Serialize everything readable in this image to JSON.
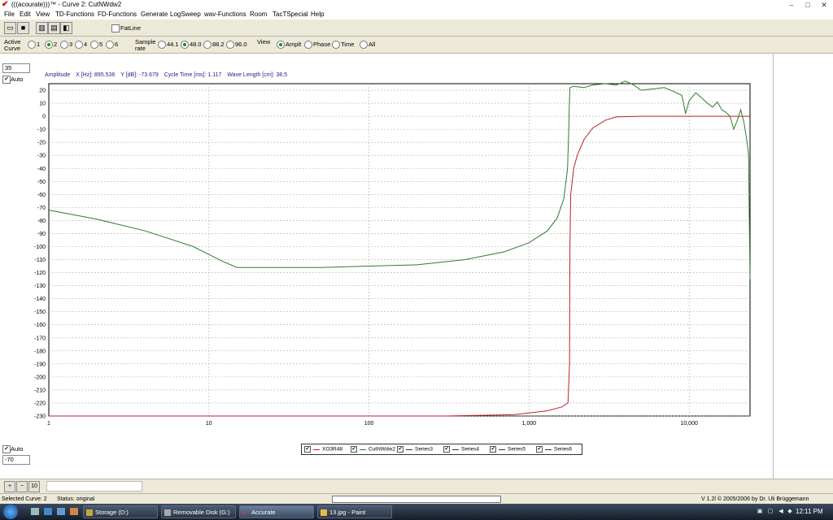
{
  "window": {
    "title": "(((acourate)))™ - Curve 2: CutNWdw2",
    "minimize": "–",
    "maximize": "□",
    "close": "✕"
  },
  "menu": [
    "File",
    "Edit",
    "View",
    "TD-Functions",
    "FD-Functions",
    "Generate",
    "LogSweep",
    "wav-Functions",
    "Room",
    "TacTSpecial",
    "Help"
  ],
  "toolbar": {
    "fatline_label": "FatLine",
    "fatline_checked": false,
    "icons": [
      "open-folder-icon",
      "save-disk-icon",
      "copy-icon",
      "paste-icon",
      "eraser-icon"
    ]
  },
  "options": {
    "active_curve_label": "Active Curve",
    "active_curve_label_line1": "Active",
    "active_curve_label_line2": "Curve",
    "curves": [
      "1",
      "2",
      "3",
      "4",
      "5",
      "6"
    ],
    "active_curve_selected": "2",
    "sample_rate_label_line1": "Sample",
    "sample_rate_label_line2": "rate",
    "sample_rates": [
      "44.1",
      "48.0",
      "88.2",
      "96.0"
    ],
    "sample_rate_selected": "48.0",
    "view_label": "View",
    "views": [
      "Amplt",
      "Phase",
      "Time",
      "All"
    ],
    "view_selected": "Amplt"
  },
  "plot": {
    "y_max_input": "35",
    "y_min_input": "-70",
    "auto_top_label": "Auto",
    "auto_bottom_label": "Auto",
    "auto_top_checked": true,
    "auto_bottom_checked": true
  },
  "readout": {
    "amplitude": "Amplitude",
    "x": "X [Hz]: 895.536",
    "y": "Y [dB]: -73.679",
    "cycle": "Cycle Time [ms]: 1.117",
    "wavelength": "Wave Length [cm]: 38.5"
  },
  "chart_data": {
    "type": "line",
    "title": "",
    "xlabel": "",
    "ylabel": "",
    "xscale": "log",
    "xlim": [
      1,
      24000
    ],
    "ylim": [
      -230,
      25
    ],
    "x_ticks": [
      "1",
      "10",
      "100",
      "1,000",
      "10,000"
    ],
    "y_ticks": [
      "20",
      "10",
      "0",
      "-10",
      "-20",
      "-30",
      "-40",
      "-50",
      "-60",
      "-70",
      "-80",
      "-90",
      "-100",
      "-110",
      "-120",
      "-130",
      "-140",
      "-150",
      "-160",
      "-170",
      "-180",
      "-190",
      "-200",
      "-210",
      "-220",
      "-230"
    ],
    "grid": true,
    "legend_position": "bottom",
    "series": [
      {
        "name": "XO3R48",
        "color": "#c0202a",
        "x": [
          1,
          10,
          100,
          300,
          800,
          1300,
          1600,
          1750,
          1790,
          1800,
          1820,
          1900,
          2000,
          2200,
          2500,
          3000,
          3500,
          5000,
          10000,
          24000
        ],
        "y": [
          -230,
          -230,
          -230,
          -230,
          -229,
          -226,
          -223,
          -220,
          -190,
          -100,
          -60,
          -40,
          -30,
          -18,
          -9,
          -3,
          -0.5,
          0,
          0,
          0
        ]
      },
      {
        "name": "CutNWdw2",
        "color": "#2d7d2d",
        "x": [
          1,
          2,
          4,
          8,
          12,
          15,
          20,
          50,
          100,
          200,
          400,
          700,
          1000,
          1300,
          1500,
          1650,
          1740,
          1770,
          1785,
          1800,
          1900,
          2200,
          2500,
          3000,
          3500,
          4000,
          4500,
          5000,
          6000,
          7000,
          8000,
          9000,
          9500,
          10000,
          11000,
          12000,
          13000,
          14000,
          15000,
          16000,
          17000,
          18000,
          19000,
          20000,
          21000,
          22000,
          23000,
          23500,
          24000
        ],
        "y": [
          -72,
          -79,
          -88,
          -100,
          -111,
          -116,
          -116,
          -116,
          -115,
          -114,
          -110,
          -104,
          -97,
          -88,
          -78,
          -63,
          -40,
          -10,
          10,
          22,
          23,
          22,
          24,
          25,
          24,
          27,
          24,
          20,
          21,
          22,
          19,
          16,
          2,
          12,
          18,
          14,
          10,
          7,
          11,
          5,
          3,
          0,
          -10,
          -3,
          5,
          -5,
          -20,
          -30,
          -125
        ]
      },
      {
        "name": "Series3",
        "color": "#333333",
        "x": [],
        "y": []
      },
      {
        "name": "Series4",
        "color": "#333333",
        "x": [],
        "y": []
      },
      {
        "name": "Series5",
        "color": "#333333",
        "x": [],
        "y": []
      },
      {
        "name": "Series6",
        "color": "#333333",
        "x": [],
        "y": []
      }
    ]
  },
  "zoom": {
    "zoom_in": "+",
    "zoom_out": "−",
    "ten": "10"
  },
  "status": {
    "selected_curve": "Selected Curve: 2",
    "status": "Status: original",
    "version": "V 1.2l © 2005/2006 by Dr. Uli Brüggemann"
  },
  "taskbar": {
    "items": [
      {
        "label": "Storage (D:)",
        "active": false
      },
      {
        "label": "Removable Disk (G:)",
        "active": false
      },
      {
        "label": "Accurate",
        "active": true
      },
      {
        "label": "13.jpg - Paint",
        "active": false
      }
    ],
    "clock": "12:11 PM"
  },
  "colors": {
    "bg": "#ece9d8",
    "plot_bg": "#ffffff",
    "grid": "#b0b0b0",
    "readout": "#23238c"
  }
}
